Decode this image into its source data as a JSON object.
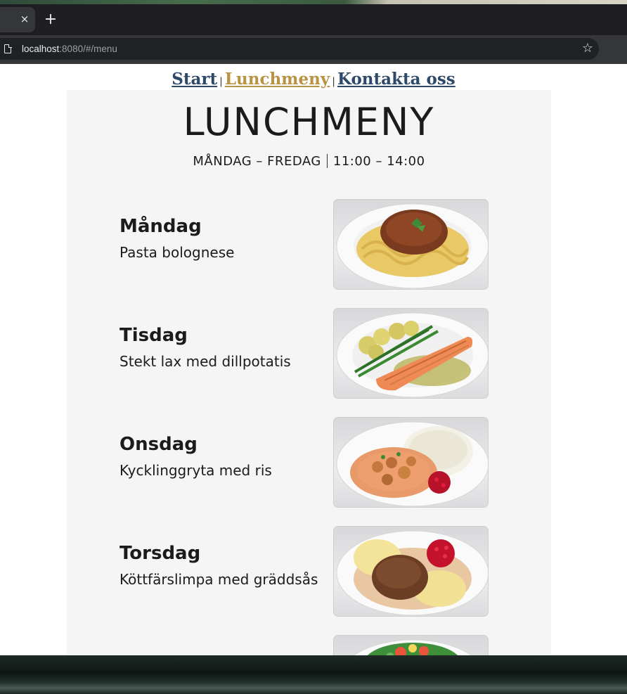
{
  "browser": {
    "tab_close_glyph": "×",
    "newtab_glyph": "+",
    "url_host": "localhost",
    "url_rest": ":8080/#/menu",
    "star_glyph": "☆"
  },
  "nav": {
    "start": "Start",
    "lunchmeny": "Lunchmeny",
    "kontakt": "Kontakta oss",
    "separator": "|",
    "active_color": "#b89344",
    "link_color": "#2f4a68"
  },
  "menu": {
    "title": "LUNCHMENY",
    "days_label": "MÅNDAG – FREDAG",
    "hours_label": "11:00 – 14:00",
    "days": [
      {
        "day": "Måndag",
        "dish": "Pasta bolognese",
        "icon": "pasta-bolognese-photo"
      },
      {
        "day": "Tisdag",
        "dish": "Stekt lax med dillpotatis",
        "icon": "salmon-photo"
      },
      {
        "day": "Onsdag",
        "dish": "Kycklinggryta med ris",
        "icon": "chicken-stew-photo"
      },
      {
        "day": "Torsdag",
        "dish": "Köttfärslimpa med gräddsås",
        "icon": "meatloaf-photo"
      },
      {
        "day": "",
        "dish": "",
        "icon": "salad-photo"
      }
    ]
  }
}
